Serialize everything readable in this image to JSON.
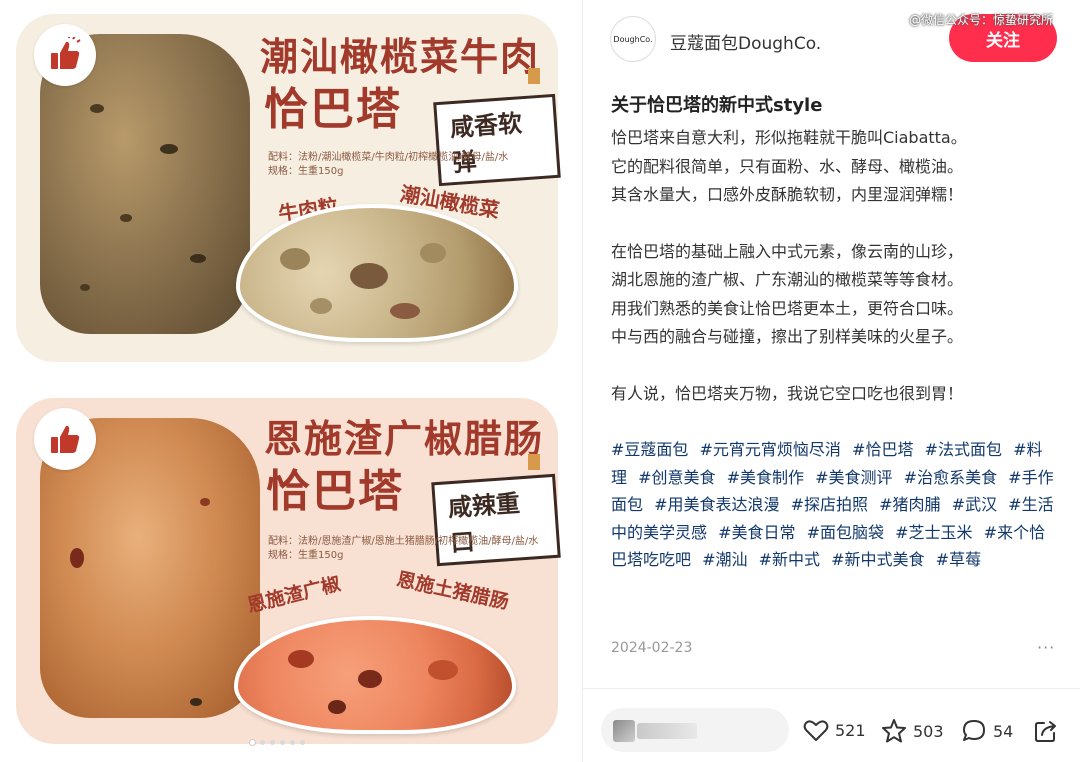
{
  "carousel": {
    "card1": {
      "title_line1": "潮汕橄榄菜牛肉",
      "title_line2": "恰巴塔",
      "tag": "咸香软弹",
      "spec_ingredients": "配料：法粉/潮汕橄榄菜/牛肉粒/初榨橄榄油/酵母/盐/水",
      "spec_weight": "规格：生重150g",
      "label_left": "牛肉粒",
      "label_right": "潮汕橄榄菜"
    },
    "card2": {
      "title_line1": "恩施渣广椒腊肠",
      "title_line2": "恰巴塔",
      "tag": "咸辣重口",
      "spec_ingredients": "配料：法粉/恩施渣广椒/恩施土猪腊肠/初榨橄榄油/酵母/盐/水",
      "spec_weight": "规格：生重150g",
      "label_left": "恩施渣广椒",
      "label_right": "恩施土猪腊肠"
    },
    "dots_total": 6,
    "dots_active": 1
  },
  "header": {
    "avatar_text": "DoughCo.",
    "author": "豆蔻面包DoughCo.",
    "follow_label": "关注",
    "watermark": "@微信公众号：惊蛰研究所"
  },
  "post": {
    "title": "关于恰巴塔的新中式style",
    "paragraphs": [
      "恰巴塔来自意大利，形似拖鞋就干脆叫Ciabatta。\n它的配料很简单，只有面粉、水、酵母、橄榄油。\n其含水量大，口感外皮酥脆软韧，内里湿润弹糯！",
      "在恰巴塔的基础上融入中式元素，像云南的山珍，\n湖北恩施的渣广椒、广东潮汕的橄榄菜等等食材。\n用我们熟悉的美食让恰巴塔更本土，更符合口味。\n中与西的融合与碰撞，擦出了别样美味的火星子。",
      "有人说，恰巴塔夹万物，我说它空口吃也很到胃！"
    ],
    "tags": [
      "#豆蔻面包",
      "#元宵元宵烦恼尽消",
      "#恰巴塔",
      "#法式面包",
      "#料理",
      "#创意美食",
      "#美食制作",
      "#美食测评",
      "#治愈系美食",
      "#手作面包",
      "#用美食表达浪漫",
      "#探店拍照",
      "#猪肉脯",
      "#武汉",
      "#生活中的美学灵感",
      "#美食日常",
      "#面包脑袋",
      "#芝士玉米",
      "#来个恰巴塔吃吃吧",
      "#潮汕",
      "#新中式",
      "#新中式美食",
      "#草莓"
    ],
    "date": "2024-02-23",
    "more": "···"
  },
  "actions": {
    "likes": "521",
    "favorites": "503",
    "comments": "54"
  }
}
